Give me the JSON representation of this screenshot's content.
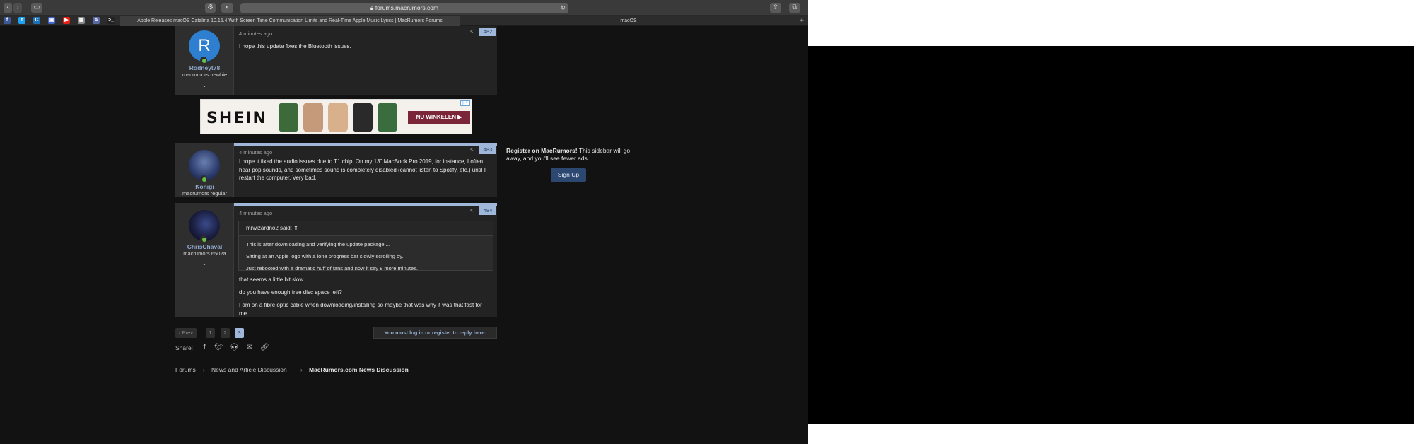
{
  "browser": {
    "url": "forums.macrumors.com",
    "tabs": [
      {
        "label": "Apple Releases macOS Catalina 10.15.4 With Screen Time Communication Limits and Real-Time Apple Music Lyrics | MacRumors Forums",
        "active": true
      },
      {
        "label": "macOS",
        "active": false
      }
    ],
    "favorites": [
      {
        "icon": "facebook-icon",
        "glyph": "f",
        "color": "#3b5998"
      },
      {
        "icon": "twitter-icon",
        "glyph": "t",
        "color": "#1da1f2"
      },
      {
        "icon": "c-icon",
        "glyph": "C",
        "color": "#1d72b8"
      },
      {
        "icon": "square-icon",
        "glyph": "▣",
        "color": "#4466cc"
      },
      {
        "icon": "youtube-icon",
        "glyph": "▶",
        "color": "#e62117"
      },
      {
        "icon": "colorful-icon",
        "glyph": "▦",
        "color": "#888888"
      },
      {
        "icon": "a-icon",
        "glyph": "A",
        "color": "#5a6aa8"
      },
      {
        "icon": "terminal-icon",
        "glyph": ">_",
        "color": "#222222"
      }
    ]
  },
  "posts": [
    {
      "user_initial": "R",
      "username": "Rodneyt78",
      "user_title": "macrumors newbie",
      "time": "4 minutes ago",
      "number": "#82",
      "message": "I hope this update fixes the Bluetooth issues."
    },
    {
      "username": "Konigi",
      "user_title": "macrumors regular",
      "time": "4 minutes ago",
      "number": "#83",
      "message": "I hope it fixed the audio issues due to T1 chip. On my 13\" MacBook Pro 2019, for instance, I often hear pop sounds, and sometimes sound is completely disabled (cannot listen to Spotify, etc.) until I restart the computer. Very bad."
    },
    {
      "username": "ChrisChaval",
      "user_title": "macrumors 6502a",
      "time": "4 minutes ago",
      "number": "#84",
      "quote": {
        "author": "mrwizardno2 said:",
        "lines": [
          "This is after downloading and verifying the update package....",
          "Sitting at an Apple logo with a lone progress bar slowly scrolling by.",
          "Just rebooted with a dramatic huff of fans and now it say 8 more minutes."
        ]
      },
      "paragraphs": [
        "that seems a little bit slow ...",
        "do you have enough free disc space left?",
        "I am on a fibre optic cable when downloading/installing so maybe that was why it was that fast for me"
      ]
    }
  ],
  "ad": {
    "brand": "SHEIN",
    "cta": "NU WINKELEN ▶"
  },
  "sidebar": {
    "bold": "Register on MacRumors!",
    "text": " This sidebar will go away, and you'll see fewer ads.",
    "button": "Sign Up"
  },
  "pagination": {
    "prev": "‹ Prev",
    "pages": [
      "1",
      "2",
      "3"
    ],
    "current": "3"
  },
  "reply_note": "You must log in or register to reply here.",
  "share": {
    "label": "Share:",
    "icons": [
      "facebook-icon",
      "twitter-icon",
      "reddit-icon",
      "email-icon",
      "link-icon"
    ]
  },
  "breadcrumb": [
    "Forums",
    "News and Article Discussion",
    "MacRumors.com News Discussion"
  ]
}
